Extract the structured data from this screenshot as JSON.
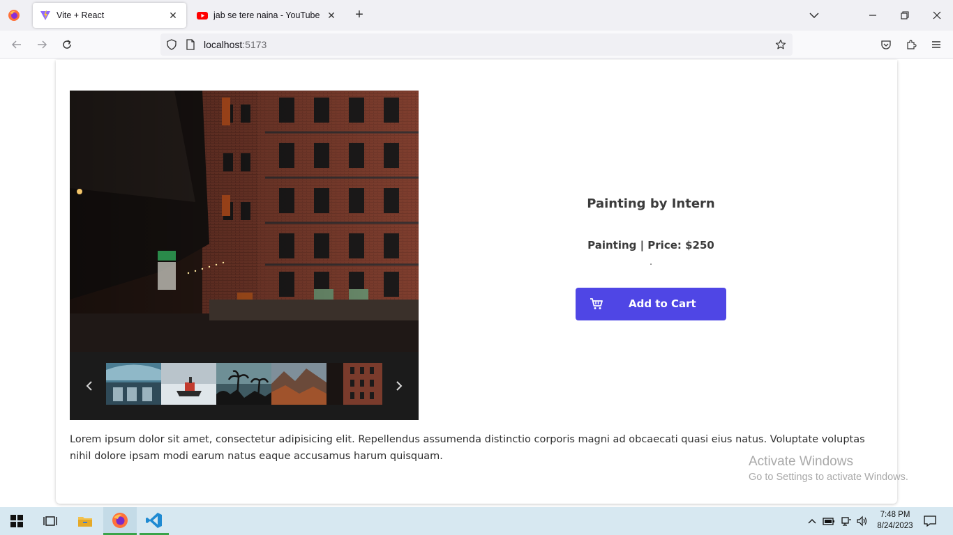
{
  "browser": {
    "tabs": [
      {
        "title": "Vite + React",
        "icon": "vite-icon",
        "active": true
      },
      {
        "title": "jab se tere naina - YouTube",
        "icon": "youtube-icon",
        "active": false
      }
    ],
    "url": {
      "host": "localhost",
      "port": ":5173"
    }
  },
  "product": {
    "title": "Painting by Intern",
    "meta": "Painting | Price: $250",
    "dot": ".",
    "add_to_cart_label": "Add to Cart",
    "accent_color": "#4f46e5"
  },
  "gallery": {
    "main_image": "brick-building-photo",
    "thumbnails": [
      "airplane-cabin-photo",
      "icebreaker-ship-photo",
      "palm-trees-photo",
      "mountain-valley-photo",
      "brick-building-photo"
    ]
  },
  "description": "Lorem ipsum dolor sit amet, consectetur adipisicing elit. Repellendus assumenda distinctio corporis magni ad obcaecati quasi eius natus. Voluptate voluptas nihil dolore ipsam modi earum natus eaque accusamus harum quisquam.",
  "watermark": {
    "line1": "Activate Windows",
    "line2": "Go to Settings to activate Windows."
  },
  "taskbar": {
    "time": "7:48 PM",
    "date": "8/24/2023"
  }
}
